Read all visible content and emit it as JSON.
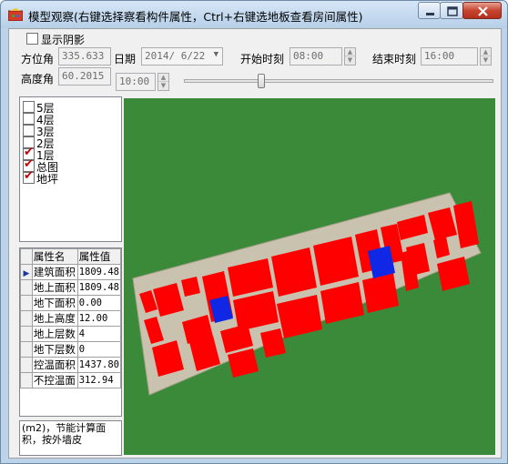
{
  "window": {
    "title": "模型观察(右键选择察看构件属性，Ctrl+右键选地板查看房间属性)"
  },
  "controls": {
    "shadow_label": "显示阴影",
    "shadow_checked": false,
    "azimuth_label": "方位角",
    "azimuth_value": "335.633",
    "altitude_label": "高度角",
    "altitude_value": "60.2015",
    "date_label": "日期",
    "date_value": "2014/ 6/22",
    "start_label": "开始时刻",
    "start_value": "08:00",
    "end_label": "结束时刻",
    "end_value": "16:00",
    "current_time": "10:00",
    "time_slider_fraction": 0.25
  },
  "layers": [
    {
      "label": "5层",
      "checked": false
    },
    {
      "label": "4层",
      "checked": false
    },
    {
      "label": "3层",
      "checked": false
    },
    {
      "label": "2层",
      "checked": false
    },
    {
      "label": "1层",
      "checked": true
    },
    {
      "label": "总图",
      "checked": true
    },
    {
      "label": "地坪",
      "checked": true
    }
  ],
  "properties": {
    "headers": [
      "属性名",
      "属性值"
    ],
    "rows": [
      {
        "name": "建筑面积",
        "value": "1809.48",
        "selected": true
      },
      {
        "name": "地上面积",
        "value": "1809.48",
        "selected": false
      },
      {
        "name": "地下面积",
        "value": "0.00",
        "selected": false
      },
      {
        "name": "地上高度",
        "value": "12.00",
        "selected": false
      },
      {
        "name": "地上层数",
        "value": "4",
        "selected": false
      },
      {
        "name": "地下层数",
        "value": "0",
        "selected": false
      },
      {
        "name": "控温面积",
        "value": "1437.80",
        "selected": false
      },
      {
        "name": "不控温面",
        "value": "312.94",
        "selected": false
      }
    ]
  },
  "hint": "(m2)，节能计算面积，按外墙皮",
  "colors": {
    "viewport_background": "#3a8a3a",
    "rooms": "#ff0000",
    "highlighted_rooms": "#1028e6",
    "walls": "#c8c0a8",
    "checkmark": "#c00000"
  }
}
